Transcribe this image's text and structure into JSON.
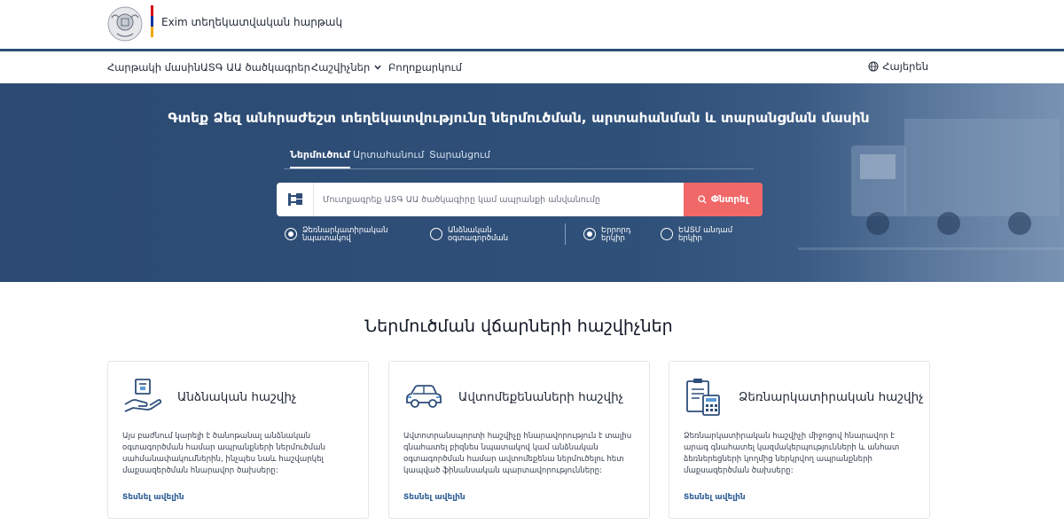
{
  "header": {
    "site_title": "Exim տեղեկատվական հարթակ",
    "flag_colors": [
      "#d90012",
      "#0033a0",
      "#f2a800"
    ]
  },
  "nav": {
    "items": [
      {
        "label": "Հարթակի մասին"
      },
      {
        "label": "ԱՏԳ ԱԱ ծածկագրեր"
      },
      {
        "label": "Հաշվիչներ"
      },
      {
        "label": "Բողոքարկում"
      }
    ],
    "language": "Հայերեն"
  },
  "hero": {
    "title": "Գտեք Ձեզ անհրաժեշտ տեղեկատվությունը ներմուծման, արտահանման և տարանցման մասին",
    "tabs": [
      {
        "label": "Ներմուծում",
        "active": true
      },
      {
        "label": "Արտահանում",
        "active": false
      },
      {
        "label": "Տարանցում",
        "active": false
      }
    ],
    "search": {
      "placeholder": "Մուտքագրեք ԱՏԳ ԱԱ ծածկագիրը կամ ապրանքի անվանումը",
      "button_label": "Փնտրել"
    },
    "radios": [
      {
        "label": "Ձեռնարկատիրական նպատակով",
        "checked": true
      },
      {
        "label": "Անձնական օգտագործման",
        "checked": false
      },
      {
        "label": "Երրորդ երկիր",
        "checked": true
      },
      {
        "label": "ԵԱՏՄ անդամ երկիր",
        "checked": false
      }
    ]
  },
  "section": {
    "title": "Ներմուծման վճարների հաշվիչներ",
    "cards": [
      {
        "icon": "hand-box-icon",
        "title": "Անձնական հաշվիչ",
        "description": "Այս բաժնում կարելի է ծանոթանալ անձնական օգտագործման համար ապրանքների ներմուծման սահմանափակումներին, ինչպես նաև հաշվարկել մաքսազերծման հնարավոր ծախսերը:",
        "link": "Տեսնել ավելին"
      },
      {
        "icon": "car-icon",
        "title": "Ավտոմեքենաների հաշվիչ",
        "description": "Ավտոտրանսպորտի հաշվիչը հնարավորություն է տալիս գնահատել բիզնես նպատակով կամ անձնական օգտագործման համար ավտոմեքենա ներմուծելու հետ կապված ֆինանսական պարտավորությունները:",
        "link": "Տեսնել ավելին"
      },
      {
        "icon": "clipboard-calculator-icon",
        "title": "Ձեռնարկատիրական հաշվիչ",
        "description": "Ձեռնարկատիրական հաշվիչի միջոցով հնարավոր է արագ գնահատել կազմակերպությունների և անհատ ձեռներեցների կողմից ներկրվող ապրանքների մաքսազերծման ծախսերը:",
        "link": "Տեսնել ավելին"
      }
    ]
  },
  "colors": {
    "hero_bg": "#2f5079",
    "accent_red": "#f06868",
    "link_blue": "#2e5d94",
    "icon_blue": "#2e4e79"
  }
}
